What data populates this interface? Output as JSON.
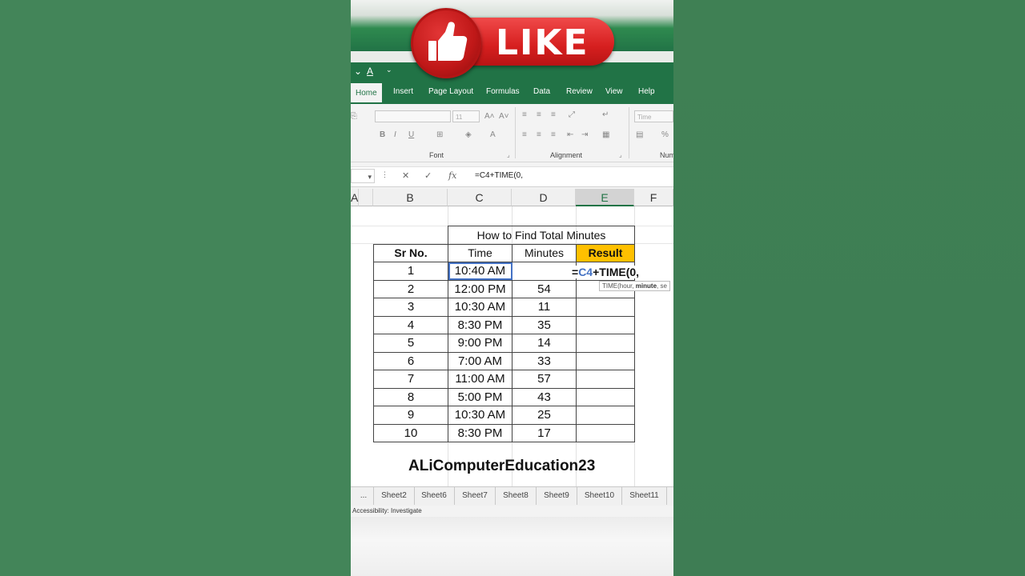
{
  "like_badge": {
    "label": "LIKE"
  },
  "ribbon": {
    "tabs": [
      "Home",
      "Insert",
      "Page Layout",
      "Formulas",
      "Data",
      "Review",
      "View",
      "Help"
    ],
    "groups": {
      "font": "Font",
      "alignment": "Alignment",
      "number": "Num"
    },
    "font_size": "11",
    "number_format": "Time"
  },
  "formula_bar": {
    "fx": "fx",
    "text": "=C4+TIME(0,"
  },
  "columns": [
    "A",
    "B",
    "C",
    "D",
    "E",
    "F"
  ],
  "table": {
    "title": "How to Find Total Minutes",
    "headers": [
      "Sr No.",
      "Time",
      "Minutes",
      "Result"
    ],
    "rows": [
      [
        "1",
        "10:40 AM",
        "",
        ""
      ],
      [
        "2",
        "12:00 PM",
        "54",
        ""
      ],
      [
        "3",
        "10:30 AM",
        "11",
        ""
      ],
      [
        "4",
        "8:30 PM",
        "35",
        ""
      ],
      [
        "5",
        "9:00 PM",
        "14",
        ""
      ],
      [
        "6",
        "7:00 AM",
        "33",
        ""
      ],
      [
        "7",
        "11:00 AM",
        "57",
        ""
      ],
      [
        "8",
        "5:00 PM",
        "43",
        ""
      ],
      [
        "9",
        "10:30 AM",
        "25",
        ""
      ],
      [
        "10",
        "8:30 PM",
        "17",
        ""
      ]
    ]
  },
  "cell_edit": {
    "eq": "=",
    "ref": "C4",
    "rest": "+TIME(0,"
  },
  "tooltip": {
    "pre": "TIME(hour, ",
    "bold": "minute",
    "post": ", se"
  },
  "watermark": "ALiComputerEducation23",
  "sheet_tabs": [
    "...",
    "Sheet2",
    "Sheet6",
    "Sheet7",
    "Sheet8",
    "Sheet9",
    "Sheet10",
    "Sheet11"
  ],
  "status": "Accessibility: Investigate"
}
